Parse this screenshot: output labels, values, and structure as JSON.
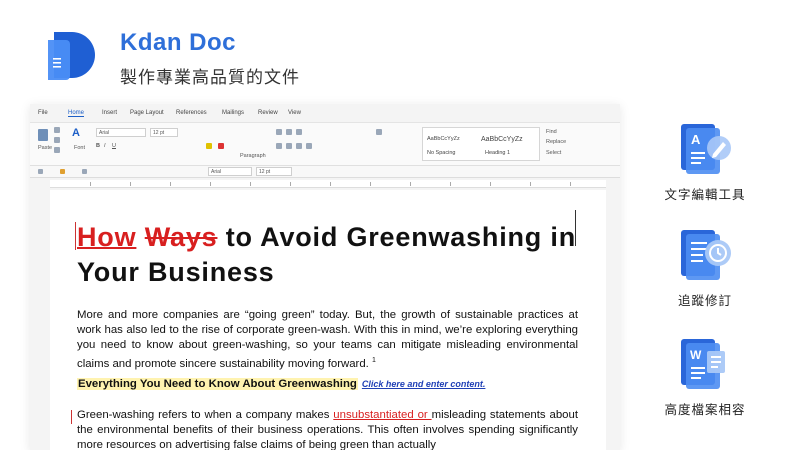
{
  "brand": {
    "name": "Kdan Doc",
    "tagline": "製作專業高品質的文件",
    "accent_color": "#2e6fd9",
    "logo_icon": "kdan-doc-logo-icon"
  },
  "editor": {
    "menu": [
      "File",
      "Home",
      "Insert",
      "Page Layout",
      "References",
      "Mailings",
      "Review",
      "View"
    ],
    "active_tab": "Home",
    "ribbon": {
      "paste": "Paste",
      "font": "Font",
      "font_name": "Arial",
      "font_size": "12 pt",
      "paragraph": "Paragraph",
      "style1_preview": "AaBbCcYyZz",
      "style1_name": "No Spacing",
      "style2_preview": "AaBbCcYyZz",
      "style2_name": "Heading 1",
      "find": "Find",
      "replace": "Replace",
      "select": "Select"
    }
  },
  "document": {
    "title_inserted": "How",
    "title_deleted": "Ways",
    "title_rest": "to Avoid Greenwashing in Your Business",
    "paragraph1": "More and more companies are “going green” today. But, the growth of sustainable practices at work has also led to the rise of corporate green-wash. With this in mind, we’re exploring everything you need to know about green-washing, so your teams can mitigate misleading environmental claims and promote sincere sustainability moving forward. ",
    "footnote_ref": "1",
    "heading": "Everything You Need to Know About Greenwashing",
    "placeholder": "Click here and enter content.",
    "paragraph2_a": "Green-washing refers to when a company makes ",
    "paragraph2_tracked": "unsubstantiated or ",
    "paragraph2_b": "misleading statements about the environmental benefits of their business operations. This often involves spending significantly more resources on advertising false claims of being green than actually",
    "tracked_change_color": "#d81f1f",
    "highlight_color": "#fff3b0"
  },
  "features": [
    "文字編輯工具",
    "追蹤修訂",
    "高度檔案相容"
  ],
  "feature_icons": [
    "text-edit-icon",
    "history-icon",
    "word-file-icon"
  ]
}
